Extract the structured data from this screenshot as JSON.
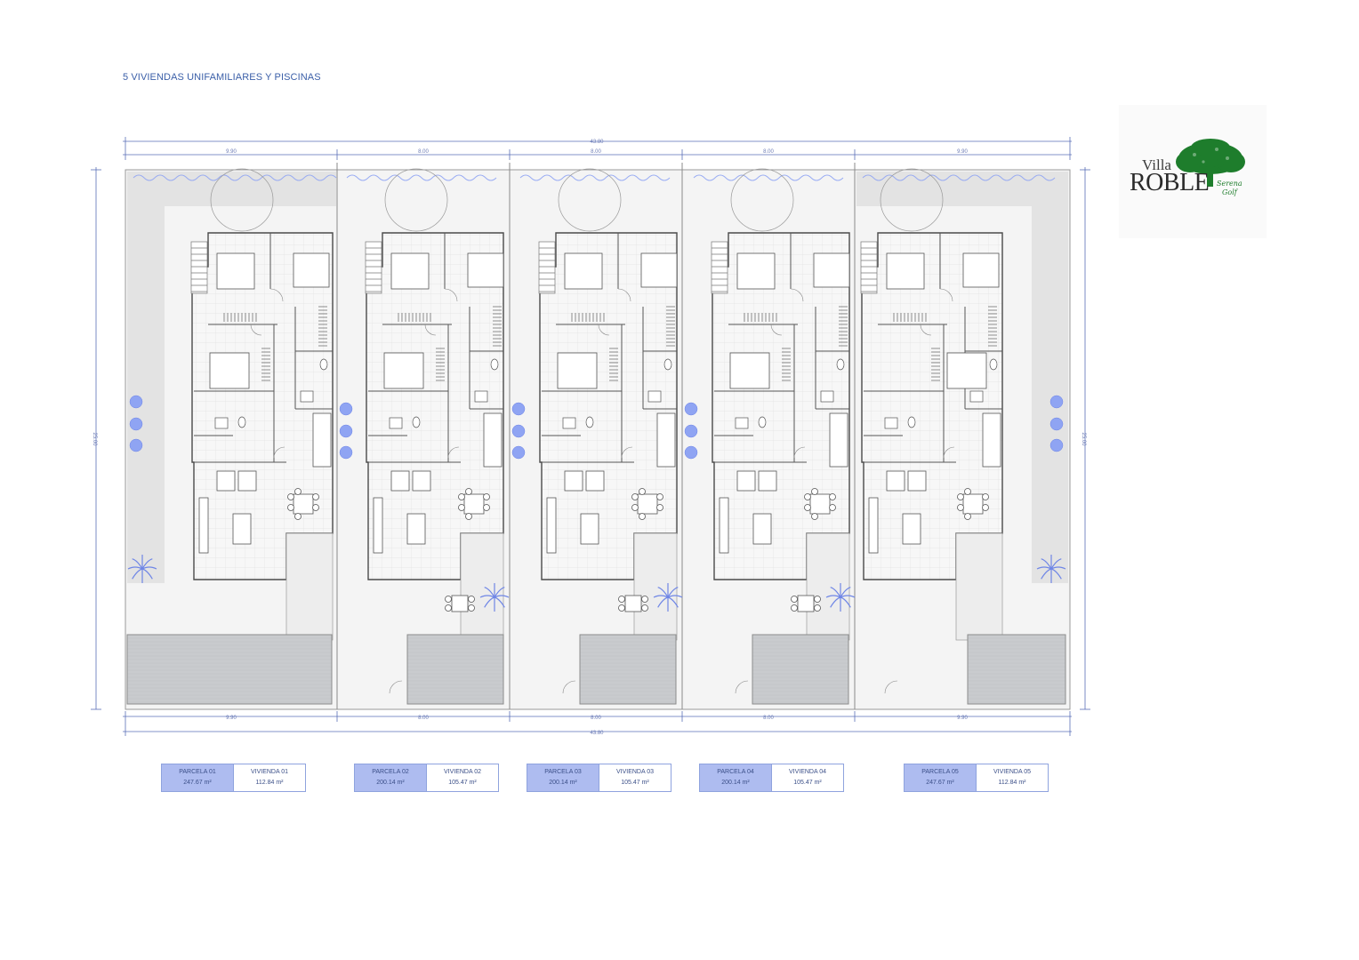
{
  "header": {
    "title": "5 VIVIENDAS UNIFAMILIARES Y PISCINAS"
  },
  "dimensions": {
    "total_width": "43.80",
    "total_depth": "25.00",
    "segments": [
      "9.90",
      "8.00",
      "8.00",
      "8.00",
      "9.90"
    ]
  },
  "logo": {
    "line1": "Villa",
    "line2": "ROBLE",
    "tag1": "Serena",
    "tag2": "Golf"
  },
  "colors": {
    "accent": "#3b5fa8",
    "table_fill": "#aebcf0",
    "pool": "#c9cbce",
    "tree": "#1e7d2c",
    "plant": "#8fa4f3"
  },
  "parcels": [
    {
      "parcel_label": "PARCELA 01",
      "parcel_area": "247.67 m²",
      "home_label": "VIVIENDA 01",
      "home_area": "112.84 m²"
    },
    {
      "parcel_label": "PARCELA 02",
      "parcel_area": "200.14 m²",
      "home_label": "VIVIENDA 02",
      "home_area": "105.47 m²"
    },
    {
      "parcel_label": "PARCELA 03",
      "parcel_area": "200.14 m²",
      "home_label": "VIVIENDA 03",
      "home_area": "105.47 m²"
    },
    {
      "parcel_label": "PARCELA 04",
      "parcel_area": "200.14 m²",
      "home_label": "VIVIENDA 04",
      "home_area": "105.47 m²"
    },
    {
      "parcel_label": "PARCELA 05",
      "parcel_area": "247.67 m²",
      "home_label": "VIVIENDA 05",
      "home_area": "112.84 m²"
    }
  ]
}
